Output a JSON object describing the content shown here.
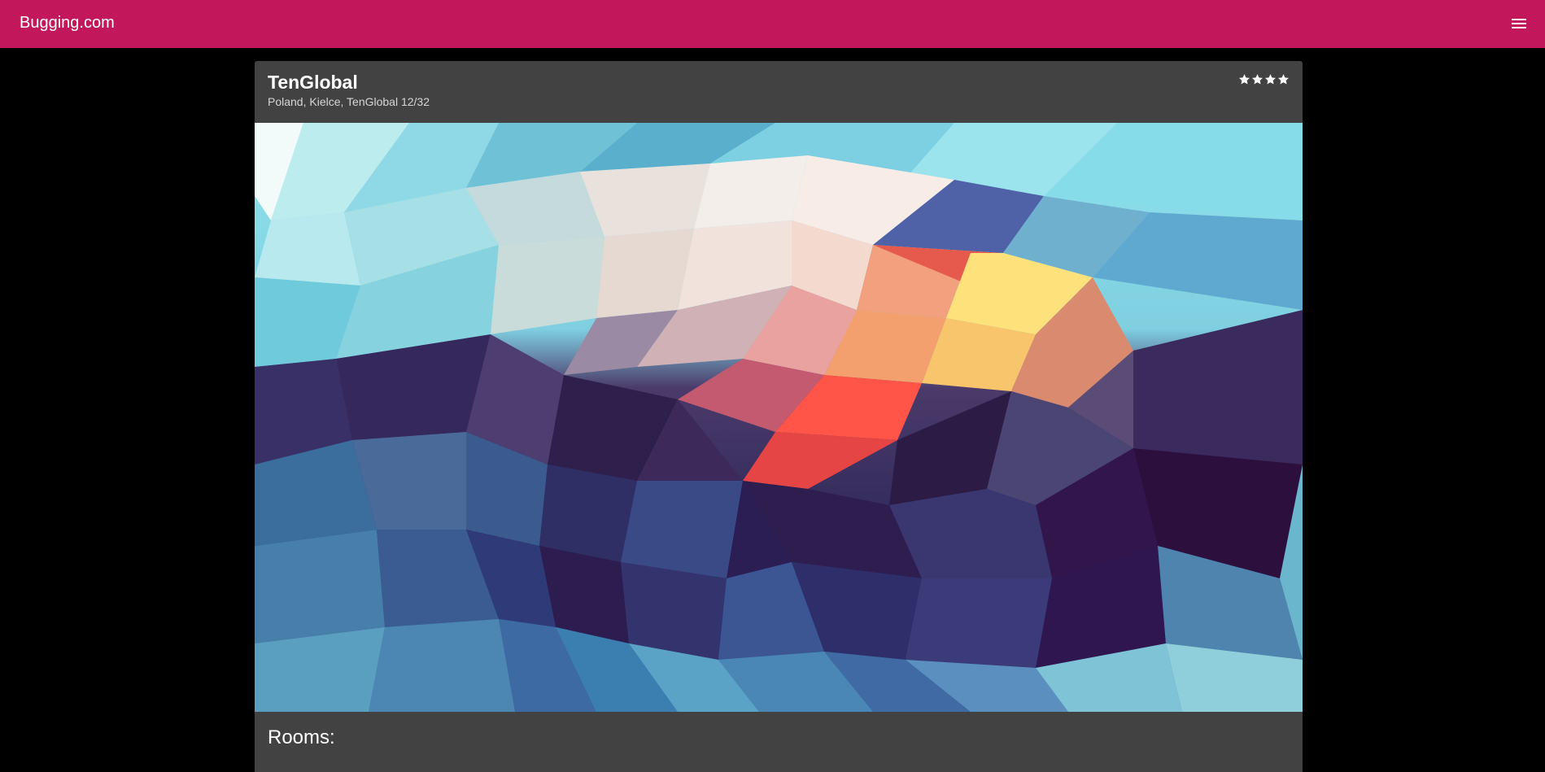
{
  "topbar": {
    "brand": "Bugging.com",
    "menu_icon": "hamburger-menu-icon",
    "color": "#c2185b"
  },
  "hotel": {
    "name": "TenGlobal",
    "address": "Poland, Kielce, TenGlobal 12/32",
    "rating": 4,
    "rating_max": 4,
    "star_icon": "star-icon"
  },
  "hero_image": {
    "type": "low-poly abstract artwork",
    "palette": [
      "#8ee6ee",
      "#5ec3da",
      "#f5f2ee",
      "#ffe27a",
      "#ff5a4a",
      "#3a2b5e",
      "#2c0f3f",
      "#3b6a99",
      "#6ab8cc"
    ]
  },
  "rooms": {
    "title": "Rooms:"
  }
}
